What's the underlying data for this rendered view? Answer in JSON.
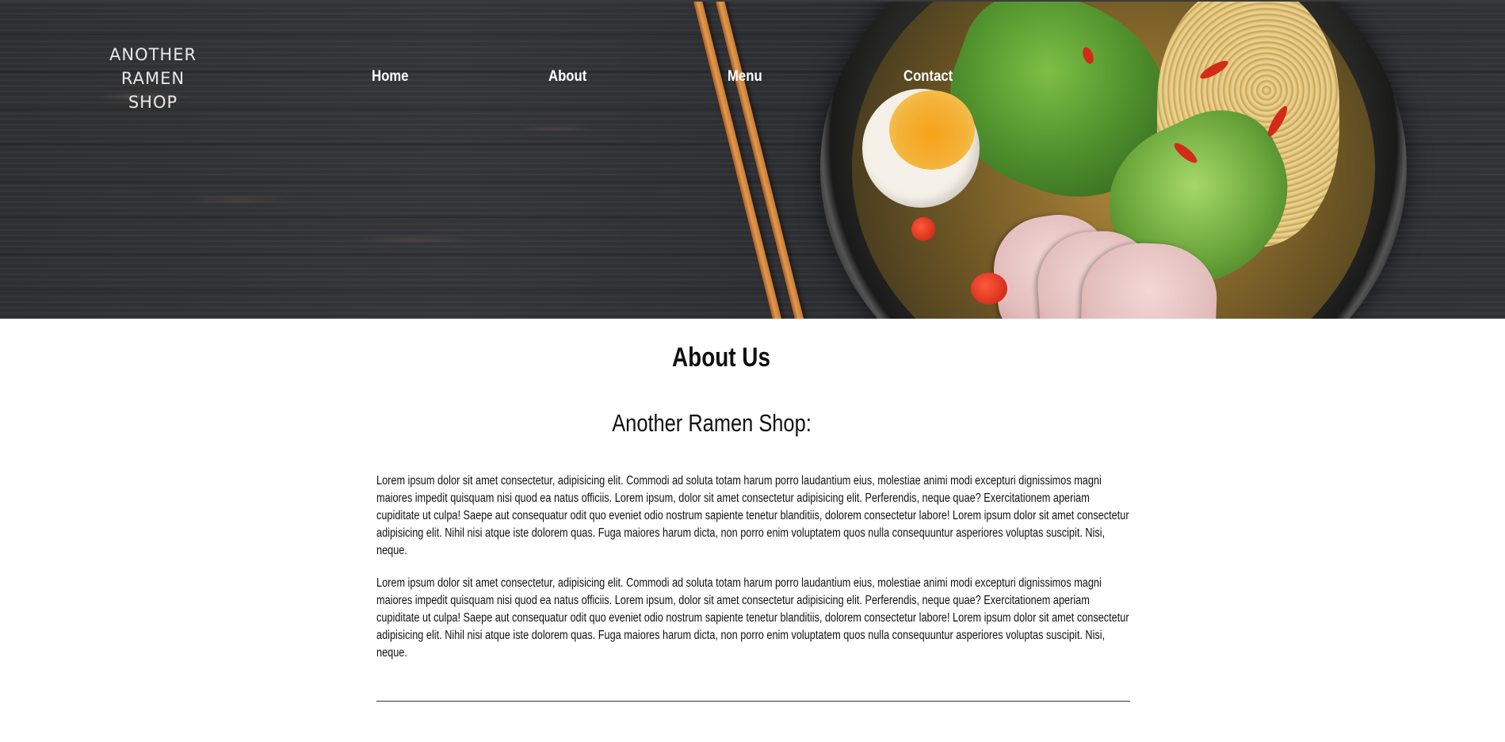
{
  "brand": {
    "logo_line1": "ANOTHER",
    "logo_line2": "RAMEN",
    "logo_line3": "SHOP"
  },
  "nav": {
    "items": [
      {
        "label": "Home"
      },
      {
        "label": "About"
      },
      {
        "label": "Menu"
      },
      {
        "label": "Contact"
      }
    ]
  },
  "main": {
    "title": "About Us",
    "subtitle": "Another Ramen Shop:",
    "paragraphs": [
      "Lorem ipsum dolor sit amet consectetur, adipisicing elit. Commodi ad soluta totam harum porro laudantium eius, molestiae animi modi excepturi dignissimos magni maiores impedit quisquam nisi quod ea natus officiis. Lorem ipsum, dolor sit amet consectetur adipisicing elit. Perferendis, neque quae? Exercitationem aperiam cupiditate ut culpa! Saepe aut consequatur odit quo eveniet odio nostrum sapiente tenetur blanditiis, dolorem consectetur labore! Lorem ipsum dolor sit amet consectetur adipisicing elit. Nihil nisi atque iste dolorem quas. Fuga maiores harum dicta, non porro enim voluptatem quos nulla consequuntur asperiores voluptas suscipit. Nisi, neque.",
      "Lorem ipsum dolor sit amet consectetur, adipisicing elit. Commodi ad soluta totam harum porro laudantium eius, molestiae animi modi excepturi dignissimos magni maiores impedit quisquam nisi quod ea natus officiis. Lorem ipsum, dolor sit amet consectetur adipisicing elit. Perferendis, neque quae? Exercitationem aperiam cupiditate ut culpa! Saepe aut consequatur odit quo eveniet odio nostrum sapiente tenetur blanditiis, dolorem consectetur labore! Lorem ipsum dolor sit amet consectetur adipisicing elit. Nihil nisi atque iste dolorem quas. Fuga maiores harum dicta, non porro enim voluptatem quos nulla consequuntur asperiores voluptas suscipit. Nisi, neque."
    ]
  },
  "colors": {
    "hero_background": "#323336",
    "nav_text": "#ffffff",
    "body_text": "#111111"
  }
}
